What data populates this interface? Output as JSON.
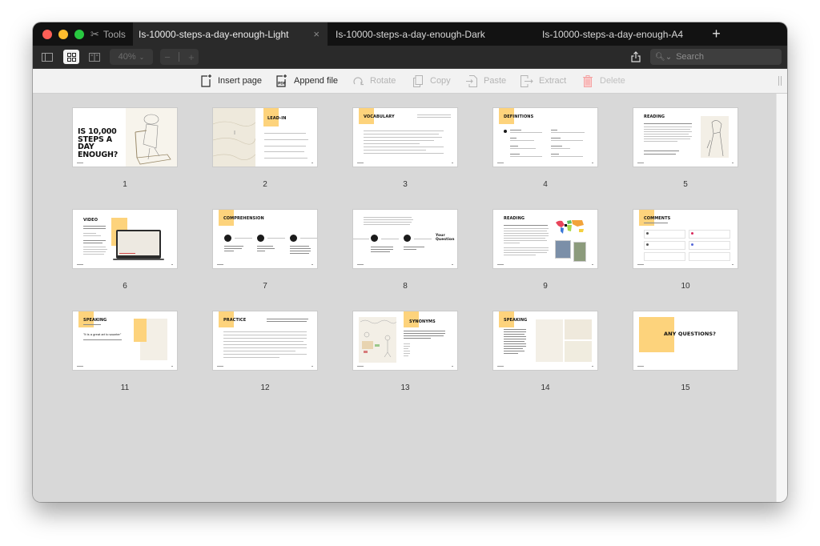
{
  "window": {
    "traffic_lights": [
      "close",
      "minimize",
      "zoom"
    ],
    "tabs": {
      "tools": {
        "icon": "tools-icon",
        "label": "Tools"
      },
      "documents": [
        {
          "label": "Is-10000-steps-a-day-enough-Light",
          "active": true,
          "close_icon": "×"
        },
        {
          "label": "Is-10000-steps-a-day-enough-Dark",
          "active": false
        },
        {
          "label": "Is-10000-steps-a-day-enough-A4",
          "active": false
        }
      ],
      "new_tab": "+"
    }
  },
  "toolbar": {
    "view_modes": [
      "sidebar-view",
      "grid-view",
      "two-page-view"
    ],
    "active_view": "grid-view",
    "zoom_level": "40%",
    "zoom_out": "−",
    "zoom_in": "+",
    "share_icon": "share-icon",
    "search": {
      "placeholder": "Search",
      "value": ""
    }
  },
  "page_actions": {
    "insert_page": "Insert page",
    "append_file": "Append file",
    "rotate": "Rotate",
    "copy": "Copy",
    "paste": "Paste",
    "extract": "Extract",
    "delete": "Delete"
  },
  "accent_color": "#fdd37c",
  "pages": [
    {
      "number": "1",
      "title": "IS 10,000 STEPS A DAY ENOUGH?",
      "layout": "cover"
    },
    {
      "number": "2",
      "title": "LEAD-IN",
      "layout": "lead-in"
    },
    {
      "number": "3",
      "title": "VOCABULARY",
      "layout": "vocabulary"
    },
    {
      "number": "4",
      "title": "DEFINITIONS",
      "layout": "definitions"
    },
    {
      "number": "5",
      "title": "READING",
      "layout": "reading-image"
    },
    {
      "number": "6",
      "title": "VIDEO",
      "layout": "video"
    },
    {
      "number": "7",
      "title": "COMPREHENSION",
      "layout": "comprehension"
    },
    {
      "number": "8",
      "title": "Your Question",
      "layout": "comprehension-cont"
    },
    {
      "number": "9",
      "title": "READING",
      "layout": "reading-map"
    },
    {
      "number": "10",
      "title": "COMMENTS",
      "layout": "comments"
    },
    {
      "number": "11",
      "title": "SPEAKING",
      "layout": "speaking-quote",
      "quote": "\"It is a great art to saunter\""
    },
    {
      "number": "12",
      "title": "PRACTICE",
      "layout": "practice"
    },
    {
      "number": "13",
      "title": "SYNONYMS",
      "layout": "synonyms"
    },
    {
      "number": "14",
      "title": "SPEAKING",
      "layout": "speaking-images"
    },
    {
      "number": "15",
      "title": "ANY QUESTIONS?",
      "layout": "closing"
    }
  ]
}
